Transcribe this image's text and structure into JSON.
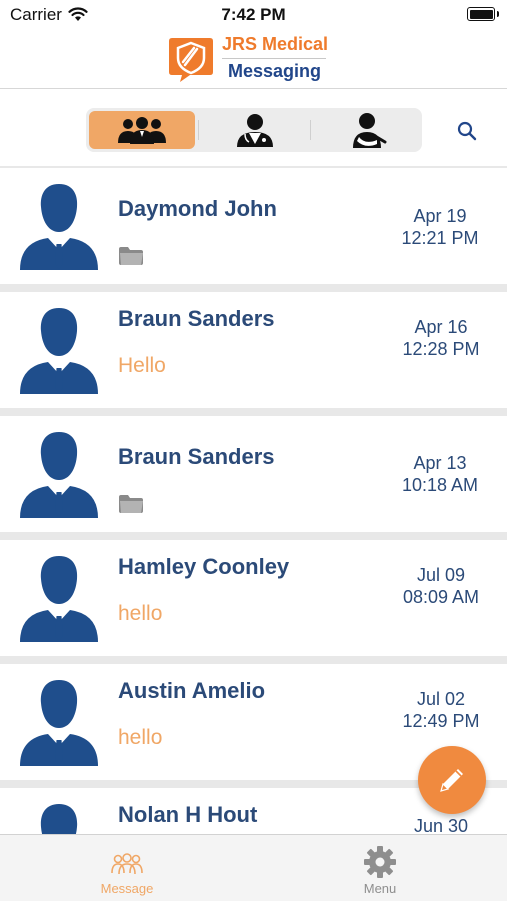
{
  "status_bar": {
    "carrier": "Carrier",
    "time": "7:42 PM"
  },
  "header": {
    "brand_line1": "JRS Medical",
    "brand_line2": "Messaging"
  },
  "segments": [
    {
      "icon": "group-icon",
      "active": true
    },
    {
      "icon": "doctor-icon",
      "active": false
    },
    {
      "icon": "patient-icon",
      "active": false
    }
  ],
  "conversations": [
    {
      "name": "Daymond John",
      "preview": "",
      "attachment": true,
      "date": "Apr 19",
      "time": "12:21 PM"
    },
    {
      "name": "Braun Sanders",
      "preview": "Hello",
      "attachment": false,
      "date": "Apr 16",
      "time": "12:28 PM"
    },
    {
      "name": "Braun Sanders",
      "preview": "",
      "attachment": true,
      "date": "Apr 13",
      "time": "10:18 AM"
    },
    {
      "name": "Hamley Coonley",
      "preview": "hello",
      "attachment": false,
      "date": "Jul 09",
      "time": "08:09 AM"
    },
    {
      "name": "Austin Amelio",
      "preview": "hello",
      "attachment": false,
      "date": "Jul 02",
      "time": "12:49 PM"
    },
    {
      "name": "Nolan H Hout",
      "preview": "",
      "attachment": false,
      "date": "Jun 30",
      "time": ""
    }
  ],
  "tabbar": {
    "message_label": "Message",
    "menu_label": "Menu"
  },
  "colors": {
    "accent": "#f08a3f",
    "navy": "#2b4a78",
    "preview": "#f0a766"
  }
}
